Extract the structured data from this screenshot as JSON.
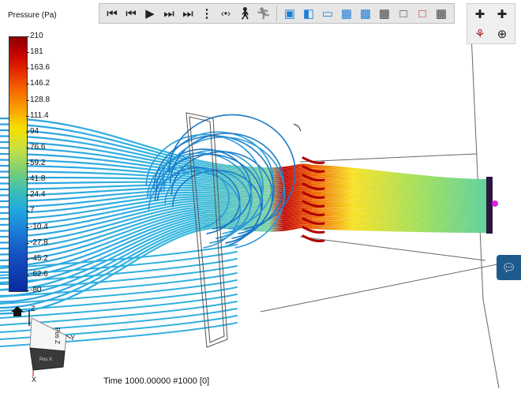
{
  "legend": {
    "title": "Pressure (Pa)",
    "ticks": [
      "210",
      "181",
      "163.6",
      "146.2",
      "128.8",
      "111.4",
      "94",
      "76.6",
      "59.2",
      "41.8",
      "24.4",
      "7",
      "-10.4",
      "-27.8",
      "-45.2",
      "-62.6",
      "-80"
    ]
  },
  "playback": {
    "first_icon": "skip-to-start-icon",
    "prev_icon": "step-back-icon",
    "play_icon": "play-icon",
    "next_icon": "step-forward-icon",
    "last_icon": "skip-to-end-icon"
  },
  "view": {
    "time_label": "Time 1000.00000  #1000 [0]",
    "triad_face_label": "Pos Z",
    "triad_side_label": "Pos X"
  },
  "axes": {
    "x": "X",
    "y": "Y",
    "z": "Z"
  },
  "colors": {
    "toolbar_bg": "#e6e6e6",
    "chat_button": "#1f5a8c",
    "view_icon_blue": "#1a7fd8"
  }
}
